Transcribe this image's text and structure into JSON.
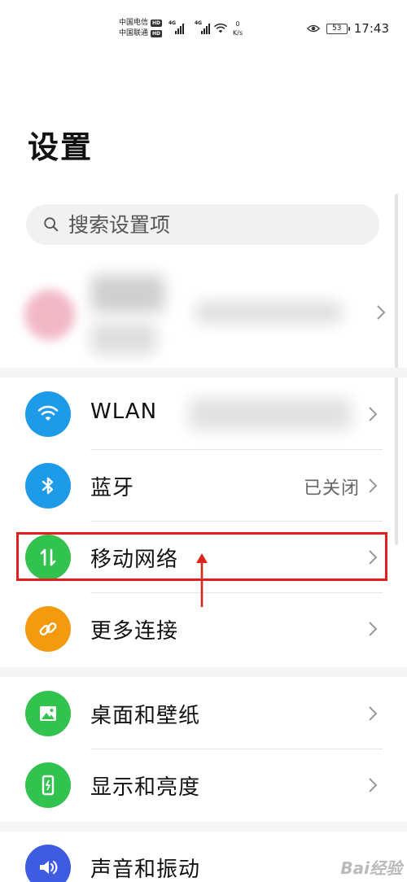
{
  "status_bar": {
    "carrier_1": "中国电信",
    "carrier_2": "中国联通",
    "hd_badge": "HD",
    "network_type": "4G",
    "speed_value": "0",
    "speed_unit": "K/s",
    "battery_level": "53",
    "time": "17:43"
  },
  "page": {
    "title": "设置"
  },
  "search": {
    "placeholder": "搜索设置项"
  },
  "settings_items": [
    {
      "id": "wlan",
      "label": "WLAN",
      "value": "",
      "icon": "wifi-icon",
      "color": "#1e9be8"
    },
    {
      "id": "bluetooth",
      "label": "蓝牙",
      "value": "已关闭",
      "icon": "bluetooth-icon",
      "color": "#1e9be8"
    },
    {
      "id": "mobile-network",
      "label": "移动网络",
      "value": "",
      "icon": "mobile-data-icon",
      "color": "#32c34f"
    },
    {
      "id": "more-connections",
      "label": "更多连接",
      "value": "",
      "icon": "link-icon",
      "color": "#f39a0e"
    },
    {
      "id": "home-wallpaper",
      "label": "桌面和壁纸",
      "value": "",
      "icon": "image-icon",
      "color": "#32c34f"
    },
    {
      "id": "display-brightness",
      "label": "显示和亮度",
      "value": "",
      "icon": "phone-display-icon",
      "color": "#32c34f"
    },
    {
      "id": "sound-vibration",
      "label": "声音和振动",
      "value": "",
      "icon": "speaker-icon",
      "color": "#3f5be0"
    }
  ],
  "watermark": {
    "text": "Bai经验"
  }
}
